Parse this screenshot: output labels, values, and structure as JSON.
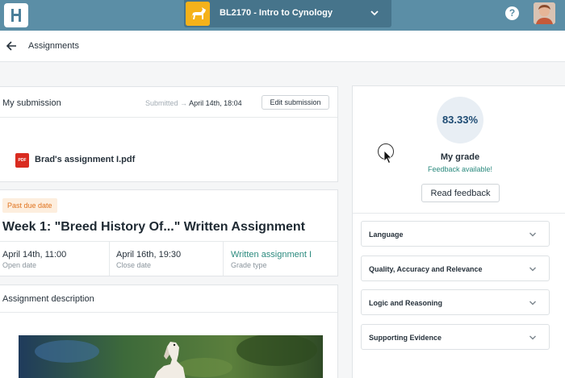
{
  "header": {
    "course_title": "BL2170 - Intro to Cynology",
    "help_symbol": "?"
  },
  "breadcrumb": {
    "label": "Assignments"
  },
  "submission": {
    "title": "My submission",
    "status_label": "Submitted",
    "status_arrow": "→",
    "submitted_date": "April 14th, 18:04",
    "edit_button": "Edit submission",
    "file_icon_text": "PDF",
    "file_name": "Brad's assignment I.pdf"
  },
  "assignment": {
    "badge": "Past due date",
    "badge_color": "#e0731e",
    "title": "Week 1: \"Breed History Of...\" Written Assignment",
    "meta": [
      {
        "value": "April 14th, 11:00",
        "label": "Open date"
      },
      {
        "value": "April 16th, 19:30",
        "label": "Close date"
      },
      {
        "value": "Written assignment I",
        "label": "Grade type"
      }
    ]
  },
  "description": {
    "title": "Assignment description"
  },
  "grade": {
    "value": "83.33%",
    "label": "My grade",
    "feedback_note": "Feedback available!",
    "read_button": "Read feedback",
    "accent_color": "#2b8a7e"
  },
  "rubric": [
    {
      "label": "Language"
    },
    {
      "label": "Quality, Accuracy and Relevance"
    },
    {
      "label": "Logic and Reasoning"
    },
    {
      "label": "Supporting Evidence"
    }
  ],
  "icons": {
    "logo": "logo-icon",
    "course": "dog-icon",
    "chevron": "chevron-down-icon",
    "help": "help-icon",
    "back": "arrow-left-icon",
    "pdf": "pdf-file-icon"
  },
  "colors": {
    "topbar": "#5b8ea6",
    "course_selector": "#46748b",
    "course_thumb": "#f5b21a",
    "pdf": "#d92b20"
  }
}
